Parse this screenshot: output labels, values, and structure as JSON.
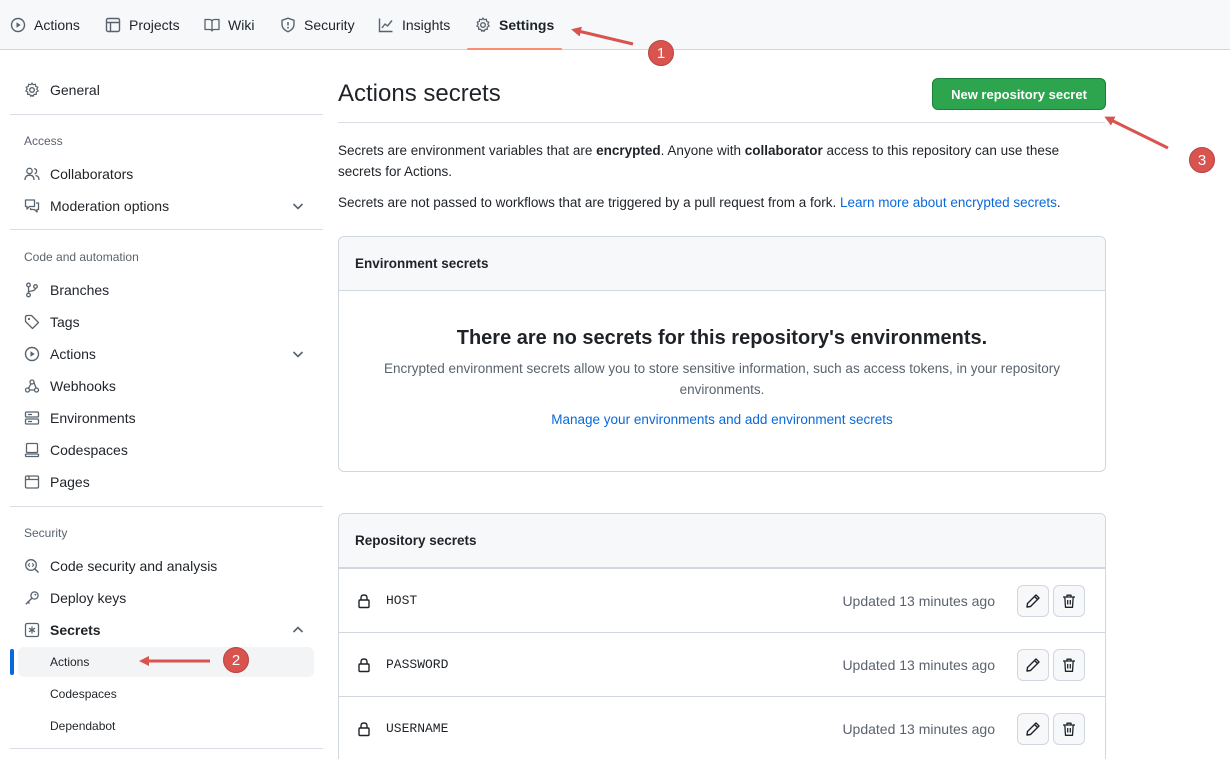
{
  "topnav": {
    "tabs": [
      {
        "label": "Actions",
        "icon": "play-icon"
      },
      {
        "label": "Projects",
        "icon": "table-icon"
      },
      {
        "label": "Wiki",
        "icon": "book-icon"
      },
      {
        "label": "Security",
        "icon": "shield-icon"
      },
      {
        "label": "Insights",
        "icon": "graph-icon"
      },
      {
        "label": "Settings",
        "icon": "gear-icon",
        "active": true
      }
    ]
  },
  "sidebar": {
    "general": "General",
    "access_heading": "Access",
    "collaborators": "Collaborators",
    "moderation": "Moderation options",
    "code_heading": "Code and automation",
    "branches": "Branches",
    "tags": "Tags",
    "actions": "Actions",
    "webhooks": "Webhooks",
    "environments": "Environments",
    "codespaces": "Codespaces",
    "pages": "Pages",
    "security_heading": "Security",
    "code_security": "Code security and analysis",
    "deploy_keys": "Deploy keys",
    "secrets": "Secrets",
    "secrets_children": [
      "Actions",
      "Codespaces",
      "Dependabot"
    ]
  },
  "main": {
    "title": "Actions secrets",
    "new_button": "New repository secret",
    "desc1_a": "Secrets are environment variables that are ",
    "desc1_b": "encrypted",
    "desc1_c": ". Anyone with ",
    "desc1_d": "collaborator",
    "desc1_e": " access to this repository can use these secrets for Actions.",
    "desc2": "Secrets are not passed to workflows that are triggered by a pull request from a fork. ",
    "desc2_link": "Learn more about encrypted secrets",
    "desc2_end": ".",
    "env_box": {
      "header": "Environment secrets",
      "blank_title": "There are no secrets for this repository's environments.",
      "blank_text": "Encrypted environment secrets allow you to store sensitive information, such as access tokens, in your repository environments.",
      "blank_link": "Manage your environments and add environment secrets"
    },
    "repo_box": {
      "header": "Repository secrets",
      "rows": [
        {
          "name": "HOST",
          "updated": "Updated 13 minutes ago"
        },
        {
          "name": "PASSWORD",
          "updated": "Updated 13 minutes ago"
        },
        {
          "name": "USERNAME",
          "updated": "Updated 13 minutes ago"
        }
      ]
    }
  },
  "annotations": [
    "1",
    "2",
    "3"
  ],
  "colors": {
    "accent": "#0969da",
    "primary_button": "#2da44e",
    "active_tab_underline": "#fd8c73",
    "annotation": "#d9534f"
  }
}
